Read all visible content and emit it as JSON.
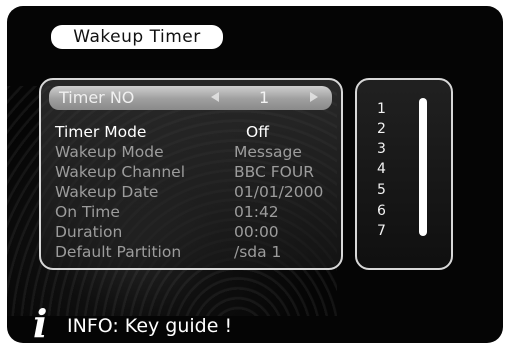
{
  "title": "Wakeup Timer",
  "selected": {
    "label": "Timer NO",
    "value": "1"
  },
  "rows": [
    {
      "label": "Timer Mode",
      "value": "Off"
    },
    {
      "label": "Wakeup Mode",
      "value": "Message"
    },
    {
      "label": "Wakeup Channel",
      "value": "BBC FOUR"
    },
    {
      "label": "Wakeup Date",
      "value": "01/01/2000"
    },
    {
      "label": "On Time",
      "value": "01:42"
    },
    {
      "label": "Duration",
      "value": "00:00"
    },
    {
      "label": "Default Partition",
      "value": "/sda 1"
    }
  ],
  "timer_list": [
    "1",
    "2",
    "3",
    "4",
    "5",
    "6",
    "7"
  ],
  "info": {
    "icon": "info-icon",
    "text": "INFO: Key guide !"
  },
  "icons": {
    "left": "arrow-left-icon",
    "right": "arrow-right-icon"
  },
  "colors": {
    "background": "#050505",
    "text": "#ffffff",
    "dim_text": "#9c9c9c",
    "selection": "#a8a8a8"
  }
}
